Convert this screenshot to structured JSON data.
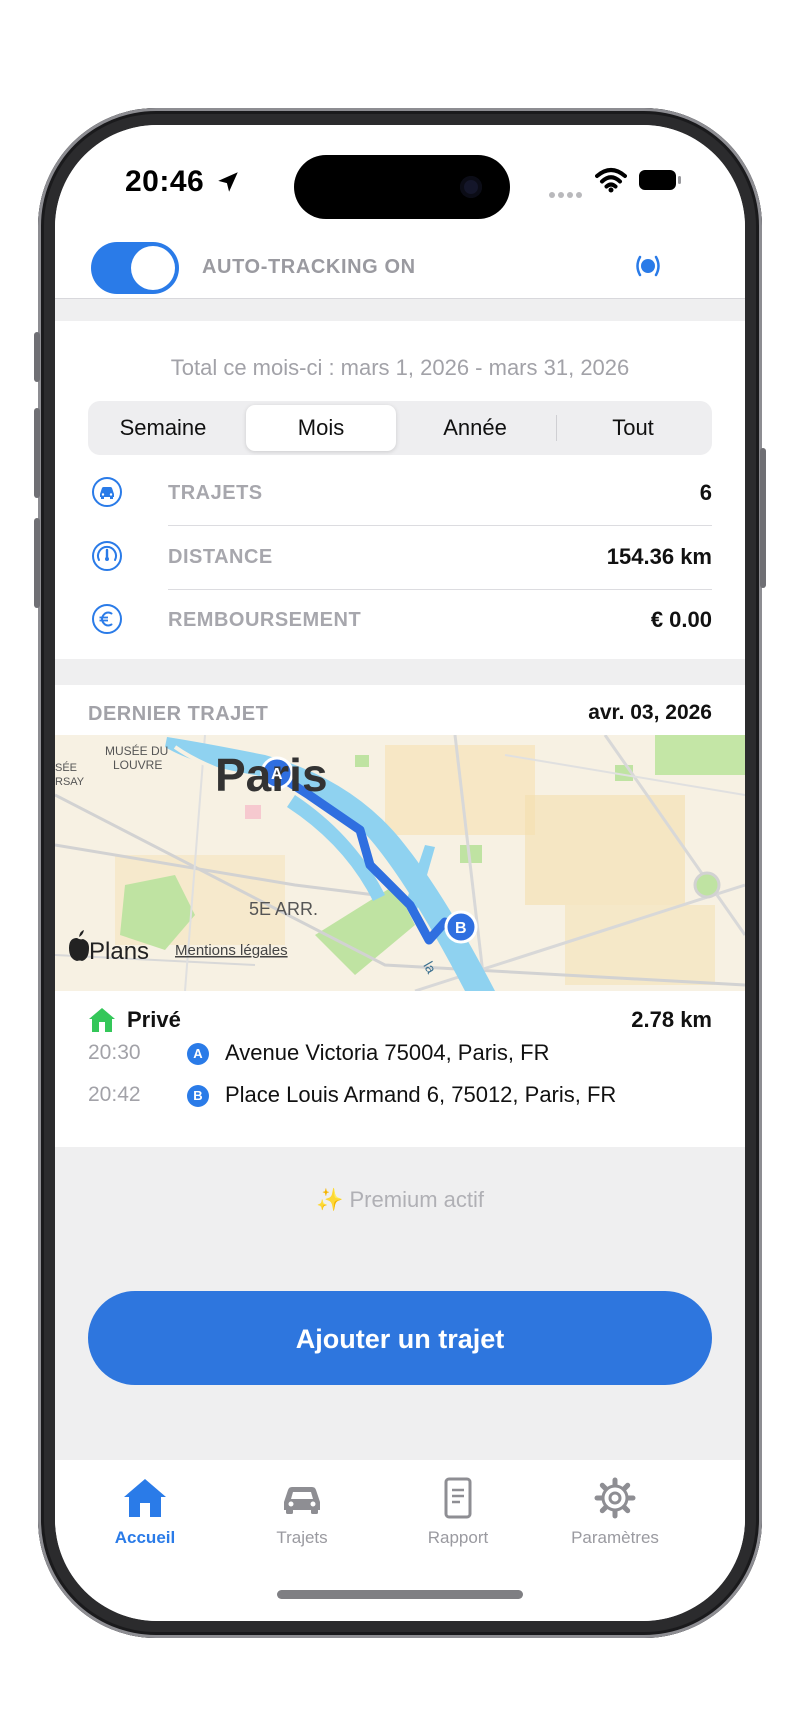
{
  "status_bar": {
    "time": "20:46"
  },
  "tracking": {
    "label": "AUTO-TRACKING ON",
    "enabled": true
  },
  "summary": {
    "title": "Total ce mois-ci : mars 1, 2026 - mars 31, 2026",
    "segments": [
      "Semaine",
      "Mois",
      "Année",
      "Tout"
    ],
    "selected_segment": "Mois",
    "stats": [
      {
        "icon": "car-icon",
        "label": "TRAJETS",
        "value": "6"
      },
      {
        "icon": "speedometer-icon",
        "label": "DISTANCE",
        "value": "154.36 km"
      },
      {
        "icon": "euro-icon",
        "label": "REMBOURSEMENT",
        "value": "€ 0.00"
      }
    ]
  },
  "last_trip": {
    "header_label": "DERNIER TRAJET",
    "date": "avr. 03, 2026",
    "map": {
      "city_label": "Paris",
      "poi_label_1": "MUSÉE DU",
      "poi_label_2": "LOUVRE",
      "edge_label_1": "SÉE",
      "edge_label_2": "RSAY",
      "district_label": "5E ARR.",
      "river_label": "la",
      "brand": "Plans",
      "legal": "Mentions légales",
      "marker_start": "A",
      "marker_end": "B"
    },
    "type": "Privé",
    "distance": "2.78 km",
    "stops": [
      {
        "time": "20:30",
        "badge": "A",
        "address": "Avenue Victoria 75004, Paris, FR"
      },
      {
        "time": "20:42",
        "badge": "B",
        "address": "Place Louis Armand 6, 75012, Paris, FR"
      }
    ]
  },
  "premium": {
    "text": "✨ Premium actif"
  },
  "cta": {
    "label": "Ajouter un trajet"
  },
  "tabs": [
    {
      "label": "Accueil",
      "icon": "home-icon",
      "active": true
    },
    {
      "label": "Trajets",
      "icon": "car-icon",
      "active": false
    },
    {
      "label": "Rapport",
      "icon": "report-icon",
      "active": false
    },
    {
      "label": "Paramètres",
      "icon": "gear-icon",
      "active": false
    }
  ],
  "colors": {
    "accent": "#2a7be8",
    "cta": "#2e76de",
    "home_green": "#34c759",
    "route": "#2f6fe0",
    "river": "#8fd2f0"
  }
}
